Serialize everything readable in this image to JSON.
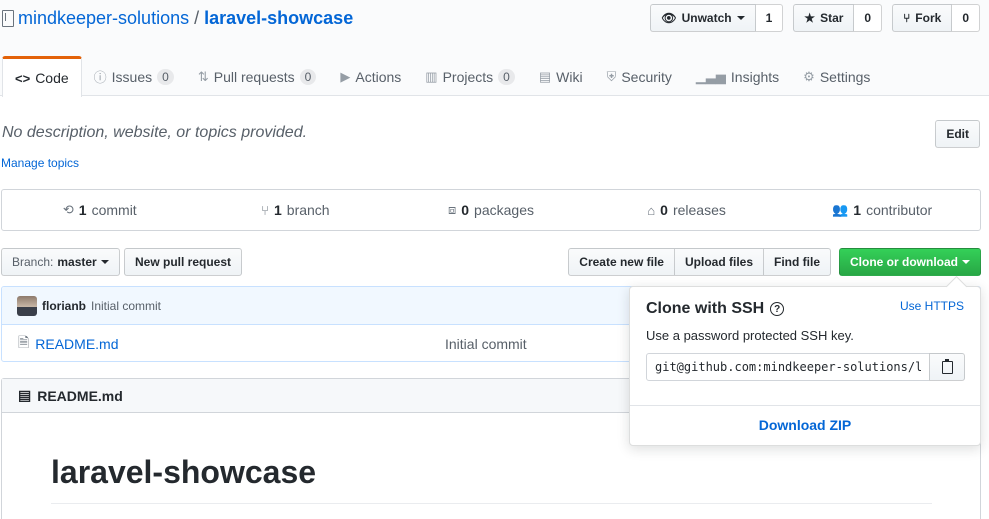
{
  "repo": {
    "owner": "mindkeeper-solutions",
    "separator": "/",
    "name": "laravel-showcase"
  },
  "actions": {
    "watch": {
      "label": "Unwatch",
      "count": "1"
    },
    "star": {
      "label": "Star",
      "count": "0"
    },
    "fork": {
      "label": "Fork",
      "count": "0"
    }
  },
  "tabs": [
    {
      "label": "Code",
      "icon": "code-icon",
      "count": ""
    },
    {
      "label": "Issues",
      "icon": "issue-icon",
      "count": "0"
    },
    {
      "label": "Pull requests",
      "icon": "pull-request-icon",
      "count": "0"
    },
    {
      "label": "Actions",
      "icon": "play-icon",
      "count": ""
    },
    {
      "label": "Projects",
      "icon": "project-icon",
      "count": "0"
    },
    {
      "label": "Wiki",
      "icon": "book-icon",
      "count": ""
    },
    {
      "label": "Security",
      "icon": "shield-icon",
      "count": ""
    },
    {
      "label": "Insights",
      "icon": "graph-icon",
      "count": ""
    },
    {
      "label": "Settings",
      "icon": "gear-icon",
      "count": ""
    }
  ],
  "about": {
    "description": "No description, website, or topics provided.",
    "manage_topics": "Manage topics",
    "edit_label": "Edit"
  },
  "summary": {
    "commits": {
      "count": "1",
      "label": "commit"
    },
    "branches": {
      "count": "1",
      "label": "branch"
    },
    "packages": {
      "count": "0",
      "label": "packages"
    },
    "releases": {
      "count": "0",
      "label": "releases"
    },
    "contributors": {
      "count": "1",
      "label": "contributor"
    }
  },
  "filebar": {
    "branch_prefix": "Branch:",
    "branch": "master",
    "new_pr": "New pull request",
    "create_file": "Create new file",
    "upload_files": "Upload files",
    "find_file": "Find file",
    "clone": "Clone or download"
  },
  "commit": {
    "author": "florianb",
    "message": "Initial commit"
  },
  "files": [
    {
      "name": "README.md",
      "message": "Initial commit"
    }
  ],
  "readme": {
    "filename": "README.md",
    "heading": "laravel-showcase"
  },
  "clone_popover": {
    "title": "Clone with SSH",
    "help": "?",
    "switch": "Use HTTPS",
    "description": "Use a password protected SSH key.",
    "url": "git@github.com:mindkeeper-solutions/laravel-showcase.git",
    "download": "Download ZIP"
  },
  "colors": {
    "link": "#0366d6",
    "accent_tab": "#e36209",
    "green": "#28a745"
  }
}
